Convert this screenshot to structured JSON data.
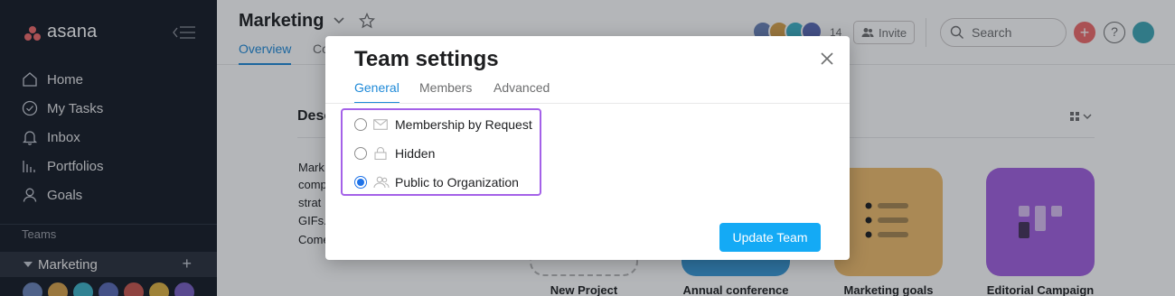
{
  "app": {
    "logo_text": "asana",
    "brand_color": "#f06a6a",
    "sidebar_bg": "#151b26"
  },
  "sidebar": {
    "items": [
      {
        "label": "Home",
        "icon": "home-icon"
      },
      {
        "label": "My Tasks",
        "icon": "check-circle-icon"
      },
      {
        "label": "Inbox",
        "icon": "bell-icon"
      },
      {
        "label": "Portfolios",
        "icon": "bar-chart-icon"
      },
      {
        "label": "Goals",
        "icon": "person-icon"
      }
    ],
    "teams_label": "Teams",
    "team": {
      "name": "Marketing",
      "add_symbol": "+"
    }
  },
  "header": {
    "title": "Marketing",
    "tabs": [
      {
        "label": "Overview",
        "active": true
      },
      {
        "label": "Co",
        "active": false
      }
    ],
    "member_count": "14",
    "invite_label": "Invite",
    "search_placeholder": "Search",
    "add_symbol": "+",
    "help_symbol": "?"
  },
  "overview": {
    "description_heading": "Desc",
    "description_lines": [
      "Mark",
      "comp",
      "strat",
      "GIFs.",
      "Come"
    ],
    "projects": [
      {
        "name": "New Project",
        "color": "",
        "icon": "dashed-placeholder"
      },
      {
        "name": "Annual conference",
        "color": "#3a9bd9",
        "icon": "calendar-icon"
      },
      {
        "name": "Marketing goals",
        "color": "#f1bd6c",
        "icon": "list-icon"
      },
      {
        "name": "Editorial Campaign",
        "color": "#a361e0",
        "icon": "board-icon"
      }
    ]
  },
  "modal": {
    "title": "Team settings",
    "tabs": [
      {
        "label": "General",
        "active": true
      },
      {
        "label": "Members",
        "active": false
      },
      {
        "label": "Advanced",
        "active": false
      }
    ],
    "privacy_options": [
      {
        "label": "Membership by Request",
        "icon": "envelope-icon",
        "checked": false
      },
      {
        "label": "Hidden",
        "icon": "lock-icon",
        "checked": false
      },
      {
        "label": "Public to Organization",
        "icon": "people-icon",
        "checked": true
      }
    ],
    "submit_label": "Update Team",
    "accent_color": "#14aaf5",
    "highlight_color": "#a461e8"
  }
}
